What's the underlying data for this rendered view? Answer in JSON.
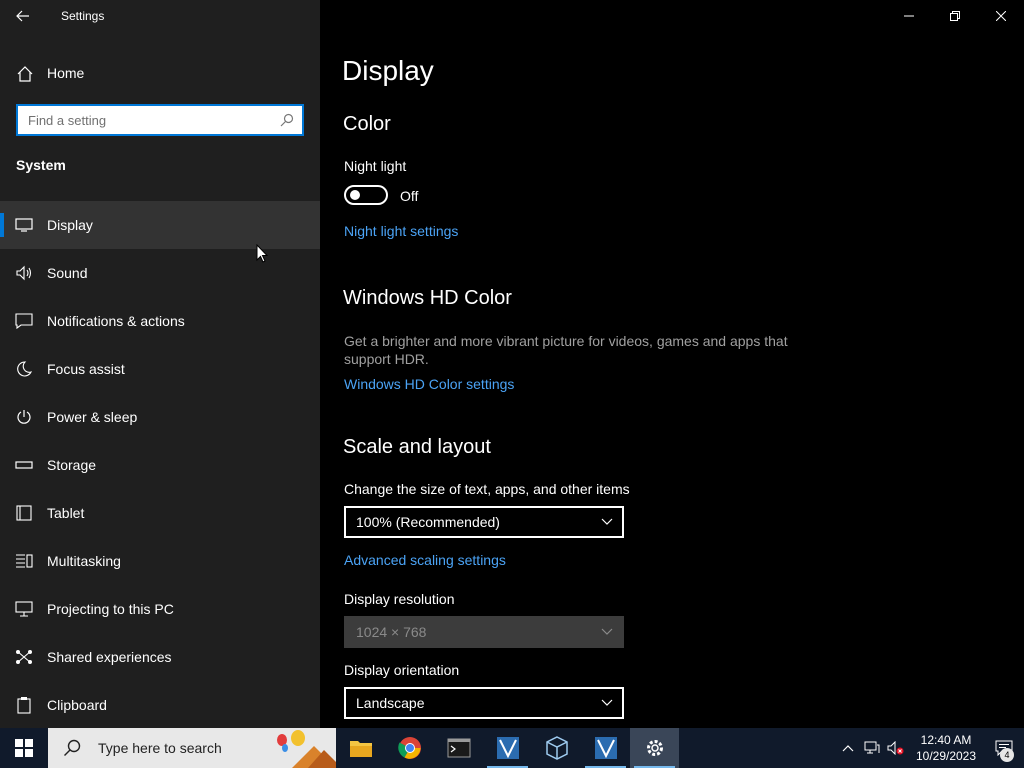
{
  "window": {
    "title": "Settings"
  },
  "sidebar": {
    "home_label": "Home",
    "search_placeholder": "Find a setting",
    "section": "System",
    "items": [
      {
        "label": "Display",
        "icon": "monitor-icon"
      },
      {
        "label": "Sound",
        "icon": "speaker-icon"
      },
      {
        "label": "Notifications & actions",
        "icon": "notification-icon"
      },
      {
        "label": "Focus assist",
        "icon": "moon-icon"
      },
      {
        "label": "Power & sleep",
        "icon": "power-icon"
      },
      {
        "label": "Storage",
        "icon": "storage-icon"
      },
      {
        "label": "Tablet",
        "icon": "tablet-icon"
      },
      {
        "label": "Multitasking",
        "icon": "multitasking-icon"
      },
      {
        "label": "Projecting to this PC",
        "icon": "projecting-icon"
      },
      {
        "label": "Shared experiences",
        "icon": "shared-icon"
      },
      {
        "label": "Clipboard",
        "icon": "clipboard-icon"
      }
    ]
  },
  "main": {
    "title": "Display",
    "color": {
      "heading": "Color",
      "night_light_label": "Night light",
      "night_light_state": "Off",
      "night_light_link": "Night light settings"
    },
    "hd_color": {
      "heading": "Windows HD Color",
      "description": "Get a brighter and more vibrant picture for videos, games and apps that support HDR.",
      "link": "Windows HD Color settings"
    },
    "scale": {
      "heading": "Scale and layout",
      "size_label": "Change the size of text, apps, and other items",
      "size_value": "100% (Recommended)",
      "advanced_link": "Advanced scaling settings",
      "resolution_label": "Display resolution",
      "resolution_value": "1024 × 768",
      "orientation_label": "Display orientation",
      "orientation_value": "Landscape"
    }
  },
  "taskbar": {
    "search_placeholder": "Type here to search",
    "clock_time": "12:40 AM",
    "clock_date": "10/29/2023",
    "notification_count": "4"
  },
  "colors": {
    "accent": "#0078d7",
    "link": "#4ba3f5",
    "sidebar_bg": "#1f1f1f"
  }
}
